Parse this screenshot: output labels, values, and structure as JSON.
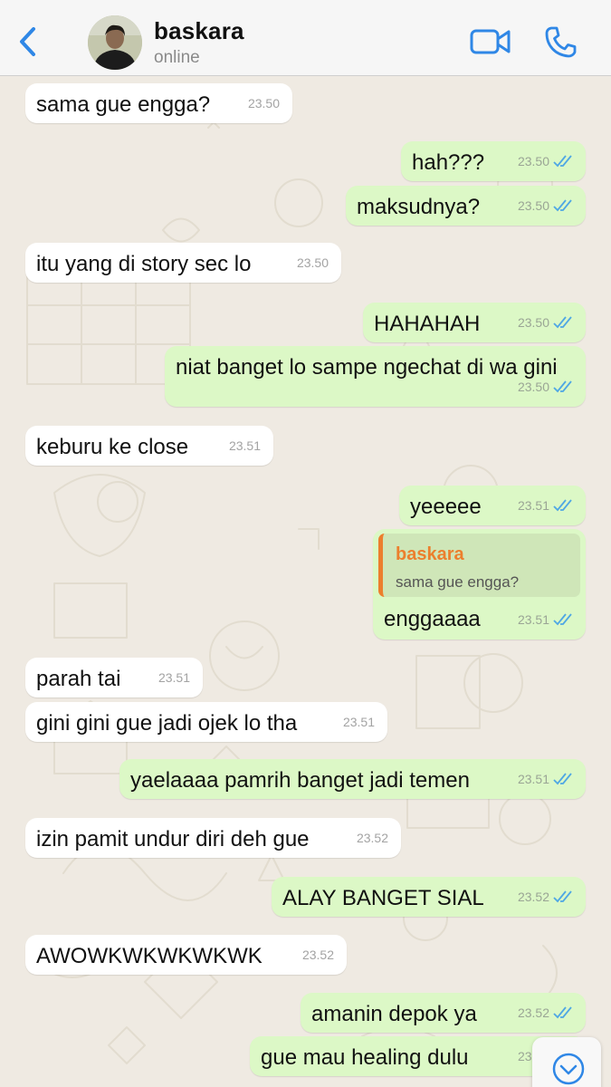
{
  "header": {
    "contact_name": "baskara",
    "status": "online"
  },
  "icons": {
    "back": "chevron-left-icon",
    "video": "video-camera-icon",
    "call": "phone-icon",
    "scroll_down": "chevron-down-circle-icon"
  },
  "colors": {
    "accent_blue": "#2f87e6",
    "outgoing_bubble": "#dcf8c6",
    "incoming_bubble": "#ffffff",
    "quote_accent": "#ec7f2d",
    "read_ticks": "#4fa7e4",
    "chat_background": "#efeae2"
  },
  "messages": [
    {
      "dir": "in",
      "text": "sama gue engga?",
      "time": "23.50"
    },
    {
      "dir": "out",
      "text": "hah???",
      "time": "23.50",
      "read": true
    },
    {
      "dir": "out",
      "text": "maksudnya?",
      "time": "23.50",
      "read": true
    },
    {
      "dir": "in",
      "text": "itu yang di story sec lo",
      "time": "23.50"
    },
    {
      "dir": "out",
      "text": "HAHAHAH",
      "time": "23.50",
      "read": true
    },
    {
      "dir": "out",
      "text": "niat banget lo sampe ngechat di wa gini",
      "time": "23.50",
      "read": true
    },
    {
      "dir": "in",
      "text": "keburu ke close",
      "time": "23.51"
    },
    {
      "dir": "out",
      "text": "yeeeee",
      "time": "23.51",
      "read": true
    },
    {
      "dir": "out",
      "text": "enggaaaa",
      "time": "23.51",
      "read": true,
      "quote": {
        "name": "baskara",
        "text": "sama gue engga?"
      }
    },
    {
      "dir": "in",
      "text": "parah tai",
      "time": "23.51"
    },
    {
      "dir": "in",
      "text": "gini gini gue jadi ojek lo tha",
      "time": "23.51"
    },
    {
      "dir": "out",
      "text": "yaelaaaa pamrih banget jadi temen",
      "time": "23.51",
      "read": true
    },
    {
      "dir": "in",
      "text": "izin pamit undur diri deh gue",
      "time": "23.52"
    },
    {
      "dir": "out",
      "text": "ALAY BANGET SIAL",
      "time": "23.52",
      "read": true
    },
    {
      "dir": "in",
      "text": "AWOWKWKWKWKWK",
      "time": "23.52"
    },
    {
      "dir": "out",
      "text": "amanin depok ya",
      "time": "23.52",
      "read": true
    },
    {
      "dir": "out",
      "text": "gue mau healing dulu",
      "time": "23.52",
      "read": true
    }
  ]
}
